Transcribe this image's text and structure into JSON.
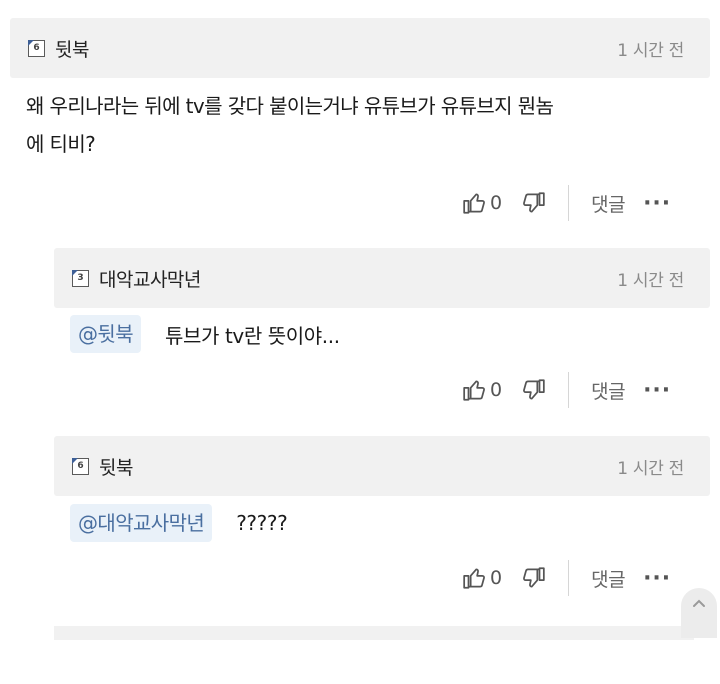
{
  "comments": [
    {
      "level": "6",
      "username": "뒷북",
      "time": "1 시간 전",
      "text_line1": "왜 우리나라는 뒤에 tv를 갖다 붙이는거냐 유튜브가 유튜브지 뭔놈",
      "text_line2": "에 티비?",
      "likes": "0",
      "reply_label": "댓글"
    },
    {
      "level": "3",
      "username": "대악교사막년",
      "time": "1 시간 전",
      "mention": "@뒷북",
      "text": "튜브가 tv란 뜻이야...",
      "likes": "0",
      "reply_label": "댓글"
    },
    {
      "level": "6",
      "username": "뒷북",
      "time": "1 시간 전",
      "mention": "@대악교사막년",
      "text": "?????",
      "likes": "0",
      "reply_label": "댓글"
    }
  ],
  "more_label": "···",
  "icons": [
    "thumbs-up-icon",
    "thumbs-down-icon",
    "more-icon",
    "scroll-top-icon"
  ]
}
